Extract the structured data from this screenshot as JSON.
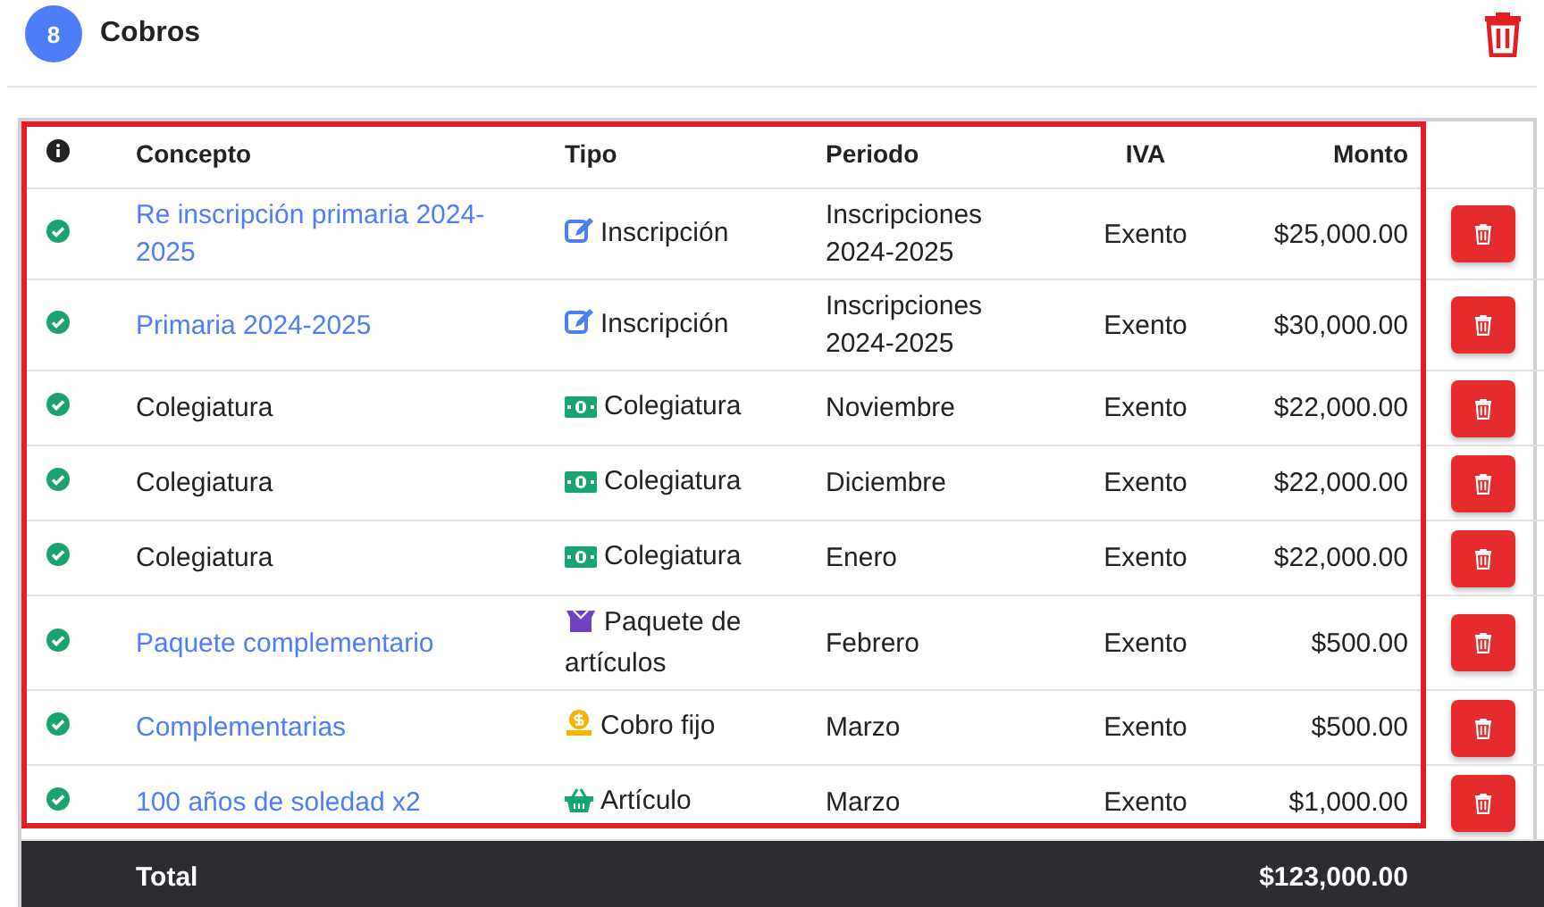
{
  "header": {
    "badge": "8",
    "title": "Cobros"
  },
  "table": {
    "columns": [
      "Concepto",
      "Tipo",
      "Periodo",
      "IVA",
      "Monto"
    ],
    "rows": [
      {
        "concepto": "Re inscripción primaria 2024-2025",
        "link": true,
        "tipo": "Inscripción",
        "kind": "edit",
        "periodo": "Inscripciones 2024-2025",
        "iva": "Exento",
        "monto": "$25,000.00"
      },
      {
        "concepto": "Primaria 2024-2025",
        "link": true,
        "tipo": "Inscripción",
        "kind": "edit",
        "periodo": "Inscripciones 2024-2025",
        "iva": "Exento",
        "monto": "$30,000.00"
      },
      {
        "concepto": "Colegiatura",
        "link": false,
        "tipo": "Colegiatura",
        "kind": "money",
        "periodo": "Noviembre",
        "iva": "Exento",
        "monto": "$22,000.00"
      },
      {
        "concepto": "Colegiatura",
        "link": false,
        "tipo": "Colegiatura",
        "kind": "money",
        "periodo": "Diciembre",
        "iva": "Exento",
        "monto": "$22,000.00"
      },
      {
        "concepto": "Colegiatura",
        "link": false,
        "tipo": "Colegiatura",
        "kind": "money",
        "periodo": "Enero",
        "iva": "Exento",
        "monto": "$22,000.00"
      },
      {
        "concepto": "Paquete complementario",
        "link": true,
        "tipo": "Paquete de artículos",
        "kind": "box",
        "periodo": "Febrero",
        "iva": "Exento",
        "monto": "$500.00"
      },
      {
        "concepto": "Complementarias",
        "link": true,
        "tipo": "Cobro fijo",
        "kind": "coin",
        "periodo": "Marzo",
        "iva": "Exento",
        "monto": "$500.00"
      },
      {
        "concepto": "100 años de soledad x2",
        "link": true,
        "tipo": "Artículo",
        "kind": "basket",
        "periodo": "Marzo",
        "iva": "Exento",
        "monto": "$1,000.00"
      }
    ],
    "total": {
      "label": "Total",
      "amount": "$123,000.00"
    }
  }
}
